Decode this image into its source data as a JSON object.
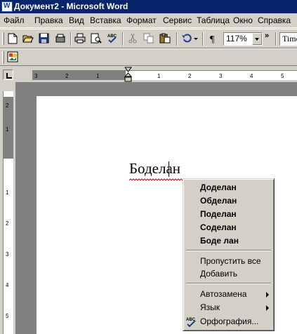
{
  "window": {
    "title": "Документ2 - Microsoft Word"
  },
  "menu": [
    "Файл",
    "Правка",
    "Вид",
    "Вставка",
    "Формат",
    "Сервис",
    "Таблица",
    "Окно",
    "Справка"
  ],
  "toolbar": {
    "zoom": "117%",
    "font_partial": "Time"
  },
  "ruler": {
    "ticks": [
      "3",
      "2",
      "1",
      "1",
      "2",
      "3",
      "4",
      "5"
    ],
    "vticks": [
      "2",
      "1",
      "1",
      "2",
      "3",
      "4",
      "5"
    ]
  },
  "document": {
    "word": "Боделан"
  },
  "context_menu": {
    "suggestions": [
      "Доделан",
      "Обделан",
      "Поделан",
      "Соделан",
      "Боде лан"
    ],
    "actions": [
      "Пропустить все",
      "Добавить"
    ],
    "submenus": [
      "Автозамена",
      "Язык"
    ],
    "spelling": "Орфография..."
  },
  "icons": [
    "new-document-icon",
    "open-folder-icon",
    "save-icon",
    "permissions-icon",
    "print-icon",
    "print-preview-icon",
    "spelling-grammar-icon",
    "cut-icon",
    "copy-icon",
    "paste-icon",
    "undo-icon",
    "show-formatting-icon",
    "toolbar-options-icon",
    "drawing-icon"
  ]
}
